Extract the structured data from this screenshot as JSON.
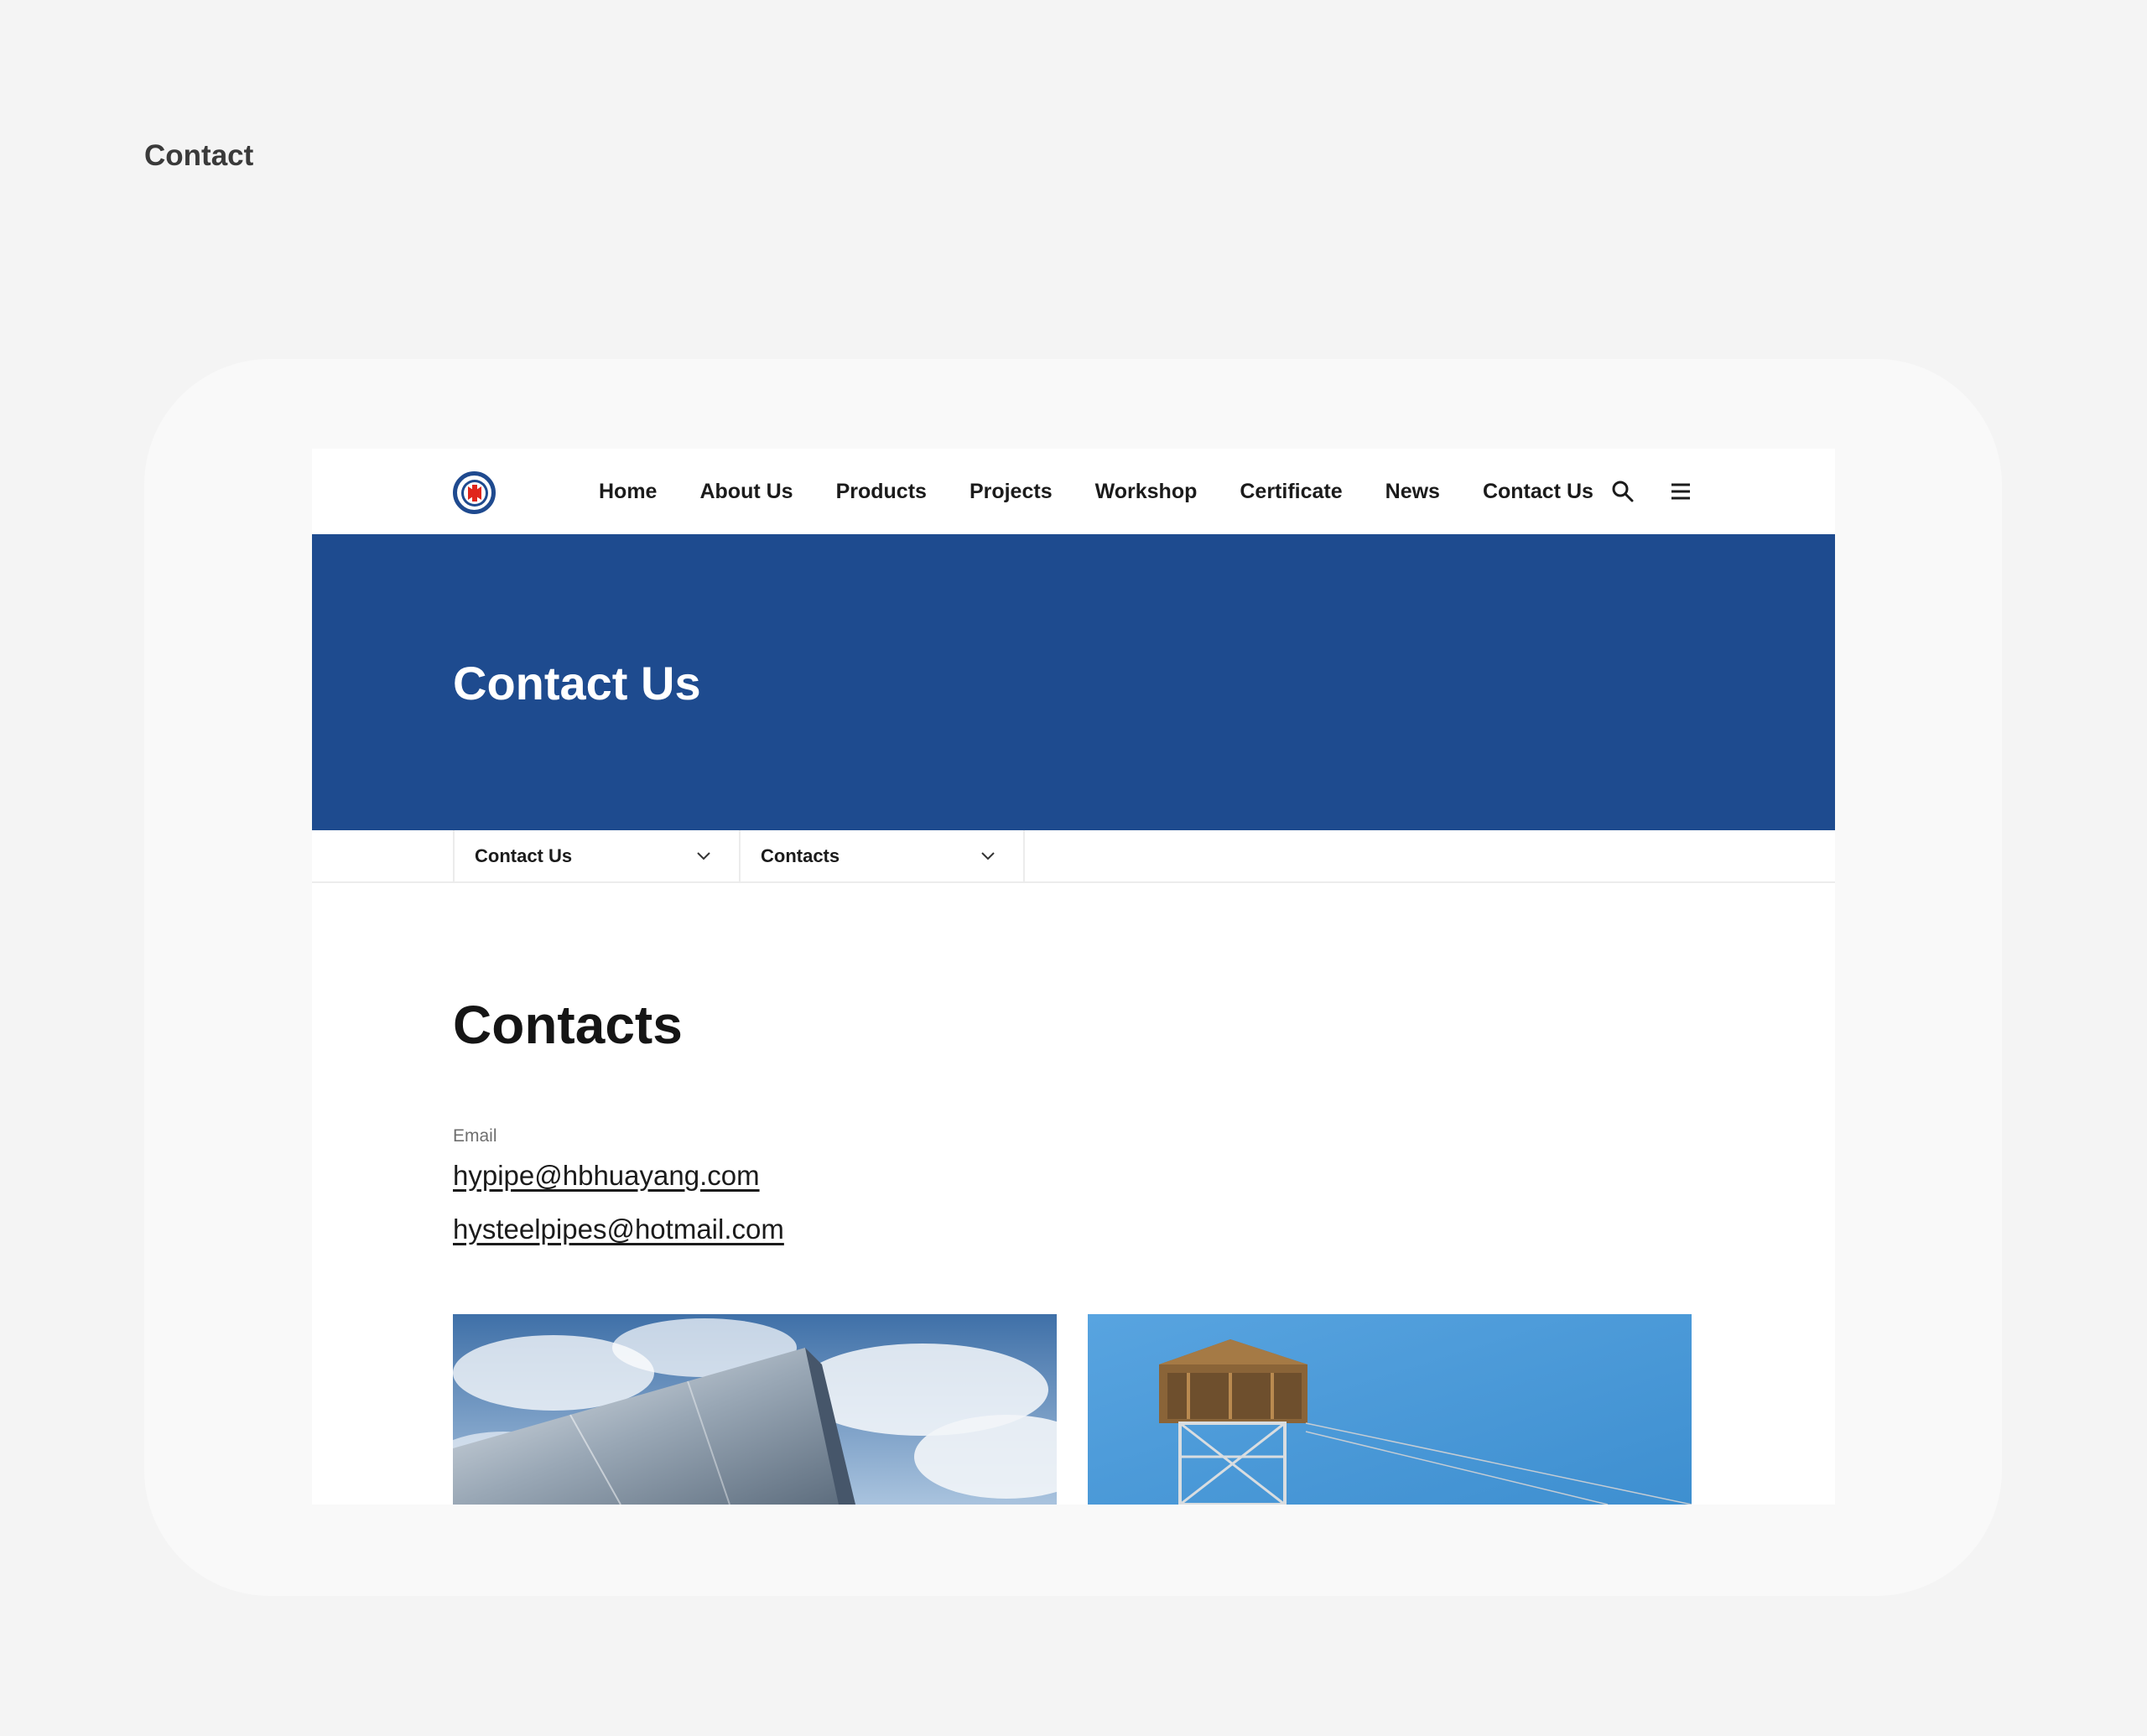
{
  "page_caption": "Contact",
  "header": {
    "logo_name": "company-logo",
    "nav": [
      "Home",
      "About Us",
      "Products",
      "Projects",
      "Workshop",
      "Certificate",
      "News",
      "Contact Us"
    ]
  },
  "banner": {
    "title": "Contact Us"
  },
  "subnav": {
    "dropdown_1": "Contact Us",
    "dropdown_2": "Contacts"
  },
  "main": {
    "heading": "Contacts",
    "email_label": "Email",
    "emails": [
      "hypipe@hbhuayang.com",
      "hysteelpipes@hotmail.com"
    ]
  },
  "colors": {
    "brand_blue": "#1e4b8f",
    "logo_red": "#e0251b",
    "page_bg": "#f4f4f4"
  }
}
